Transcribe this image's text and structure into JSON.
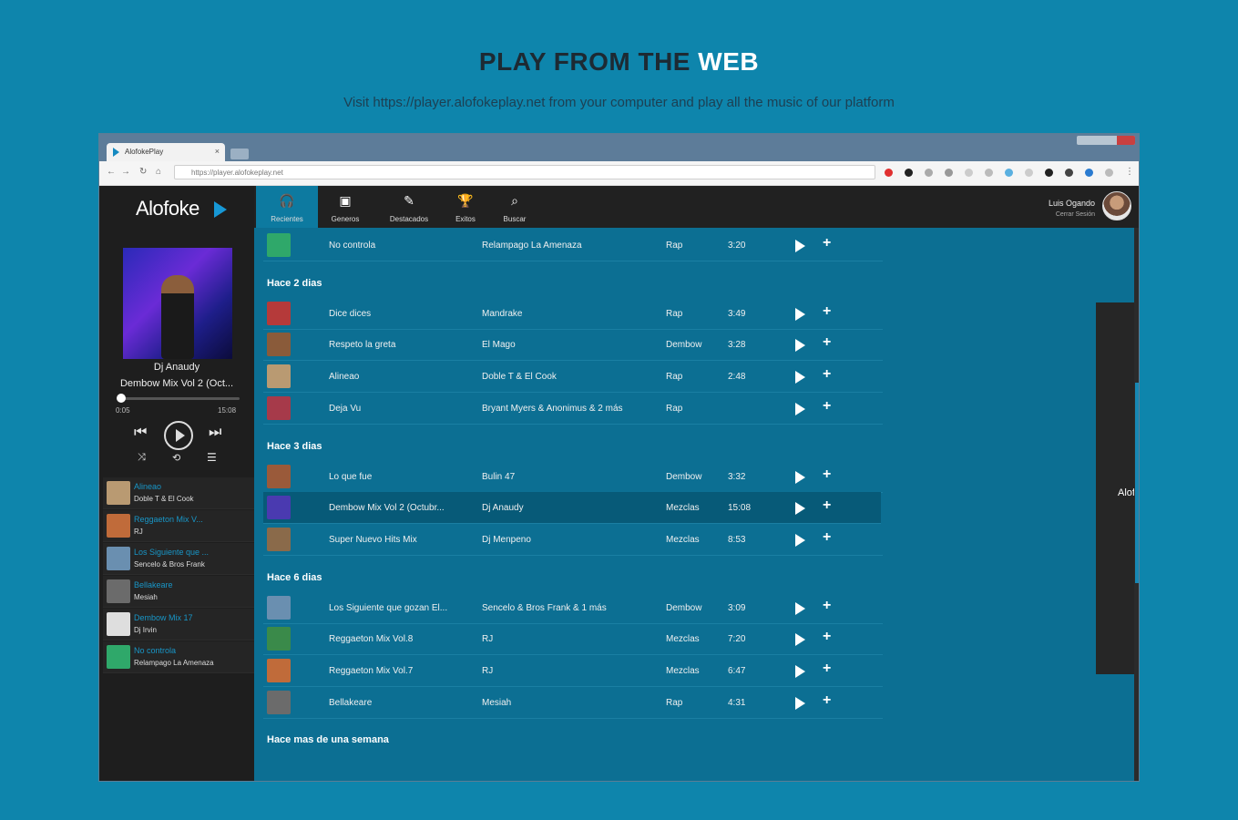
{
  "headline": {
    "part1": "PLAY FROM THE ",
    "part2": "WEB"
  },
  "subline": "Visit https://player.alofokeplay.net from your computer and play all the music of our platform",
  "browser": {
    "tab_title": "AlofokePlay",
    "tab_close": "×",
    "url": "https://player.alofokeplay.net"
  },
  "app": {
    "logo": "Alofoke",
    "now_playing": {
      "artist": "Dj Anaudy",
      "title": "Dembow Mix Vol 2 (Oct...",
      "elapsed": "0:05",
      "total": "15:08",
      "progress": 0.01
    },
    "queue": [
      {
        "title": "Alineao",
        "sub": "Doble T & El Cook",
        "color": "#b99a72"
      },
      {
        "title": "Reggaeton Mix V...",
        "sub": "RJ",
        "color": "#c06b3a"
      },
      {
        "title": "Los Siguiente que ...",
        "sub": "Sencelo & Bros Frank",
        "color": "#6a8fb0"
      },
      {
        "title": "Bellakeare",
        "sub": "Mesiah",
        "color": "#6b6b6b"
      },
      {
        "title": "Dembow Mix 17",
        "sub": "Dj Irvin",
        "color": "#dedede"
      },
      {
        "title": "No controla",
        "sub": "Relampago La Amenaza",
        "color": "#2fa86a"
      }
    ],
    "nav": [
      {
        "label": "Recientes",
        "icon": "headphones"
      },
      {
        "label": "Generos",
        "icon": "cassette"
      },
      {
        "label": "Destacados",
        "icon": "featured"
      },
      {
        "label": "Exitos",
        "icon": "trophy"
      },
      {
        "label": "Buscar",
        "icon": "search"
      }
    ],
    "user": {
      "name": "Luis Ogando",
      "sub": "Cerrar Sesión"
    },
    "sections": [
      {
        "title": "",
        "rows": [
          {
            "title": "No controla",
            "artist": "Relampago La Amenaza",
            "genre": "Rap",
            "duration": "3:20",
            "color": "#2fa86a"
          }
        ]
      },
      {
        "title": "Hace 2 dias",
        "rows": [
          {
            "title": "Dice dices",
            "artist": "Mandrake",
            "genre": "Rap",
            "duration": "3:49",
            "color": "#b53a3a"
          },
          {
            "title": "Respeto la greta",
            "artist": "El Mago",
            "genre": "Dembow",
            "duration": "3:28",
            "color": "#8a5b3a"
          },
          {
            "title": "Alineao",
            "artist": "Doble T & El Cook",
            "genre": "Rap",
            "duration": "2:48",
            "color": "#b99a72"
          },
          {
            "title": "Deja Vu",
            "artist": "Bryant Myers & Anonimus & 2 más",
            "genre": "Rap",
            "duration": "",
            "color": "#a63a4a"
          }
        ]
      },
      {
        "title": "Hace 3 dias",
        "rows": [
          {
            "title": "Lo que fue",
            "artist": "Bulin 47",
            "genre": "Dembow",
            "duration": "3:32",
            "color": "#9a5a3a"
          },
          {
            "title": "Dembow Mix Vol 2 (Octubr...",
            "artist": "Dj Anaudy",
            "genre": "Mezclas",
            "duration": "15:08",
            "color": "#4a3ab0",
            "active": true
          },
          {
            "title": "Super Nuevo Hits Mix",
            "artist": "Dj Menpeno",
            "genre": "Mezclas",
            "duration": "8:53",
            "color": "#8a6a4a"
          }
        ]
      },
      {
        "title": "Hace 6 dias",
        "rows": [
          {
            "title": "Los Siguiente que gozan El...",
            "artist": "Sencelo & Bros Frank & 1 más",
            "genre": "Dembow",
            "duration": "3:09",
            "color": "#6a8fb0"
          },
          {
            "title": "Reggaeton Mix Vol.8",
            "artist": "RJ",
            "genre": "Mezclas",
            "duration": "7:20",
            "color": "#3a8a4a"
          },
          {
            "title": "Reggaeton Mix Vol.7",
            "artist": "RJ",
            "genre": "Mezclas",
            "duration": "6:47",
            "color": "#c06b3a"
          },
          {
            "title": "Bellakeare",
            "artist": "Mesiah",
            "genre": "Rap",
            "duration": "4:31",
            "color": "#6b6b6b"
          }
        ]
      },
      {
        "title": "Hace mas de una semana",
        "rows": []
      }
    ],
    "ad_logo": "Alofoke ▶"
  }
}
